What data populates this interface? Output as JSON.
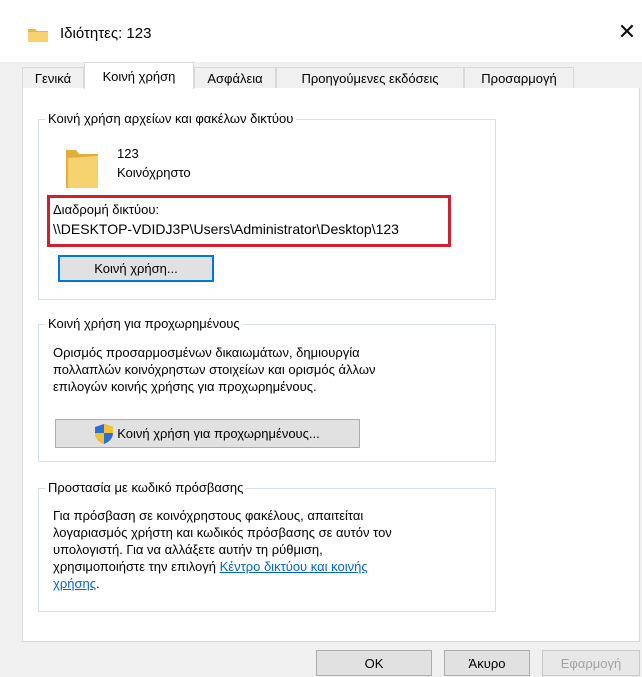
{
  "window": {
    "title": "Ιδιότητες: 123",
    "close_glyph": "✕"
  },
  "tabs": [
    {
      "label": "Γενικά",
      "active": false
    },
    {
      "label": "Κοινή χρήση",
      "active": true
    },
    {
      "label": "Ασφάλεια",
      "active": false
    },
    {
      "label": "Προηγούμενες εκδόσεις",
      "active": false
    },
    {
      "label": "Προσαρμογή",
      "active": false
    }
  ],
  "network_sharing": {
    "group_title": "Κοινή χρήση αρχείων και φακέλων δικτύου",
    "item_name": "123",
    "item_status": "Κοινόχρηστο",
    "path_label": "Διαδρομή δικτύου:",
    "path_value": "\\\\DESKTOP-VDIDJ3P\\Users\\Administrator\\Desktop\\123",
    "share_button": "Κοινή χρήση..."
  },
  "advanced_sharing": {
    "group_title": "Κοινή χρήση για προχωρημένους",
    "description_lines": [
      "Ορισμός προσαρμοσμένων δικαιωμάτων, δημιουργία",
      "πολλαπλών κοινόχρηστων στοιχείων και ορισμός άλλων",
      "επιλογών κοινής χρήσης για προχωρημένους."
    ],
    "button": "Κοινή χρήση για προχωρημένους..."
  },
  "password_protection": {
    "group_title": "Προστασία με κωδικό πρόσβασης",
    "description_lines": [
      "Για πρόσβαση σε κοινόχρηστους φακέλους, απαιτείται",
      "λογαριασμός χρήστη και κωδικός πρόσβασης σε αυτόν τον",
      "υπολογιστή. Για να αλλάξετε αυτήν τη ρύθμιση,"
    ],
    "line4_prefix": "χρησιμοποιήστε την επιλογή ",
    "link_part1": "Κέντρο δικτύου και κοινής",
    "link_part2": "χρήσης",
    "line5_suffix": "."
  },
  "footer": {
    "ok": "OK",
    "cancel": "Άκυρο",
    "apply": "Εφαρμογή"
  },
  "colors": {
    "highlight_box": "#d0202f",
    "link": "#0066cc",
    "focus_border": "#0078d7"
  },
  "icons": {
    "title_icon": "folder-icon",
    "item_icon": "folder-icon",
    "button_icon": "uac-shield-icon",
    "close_icon": "close-icon"
  }
}
